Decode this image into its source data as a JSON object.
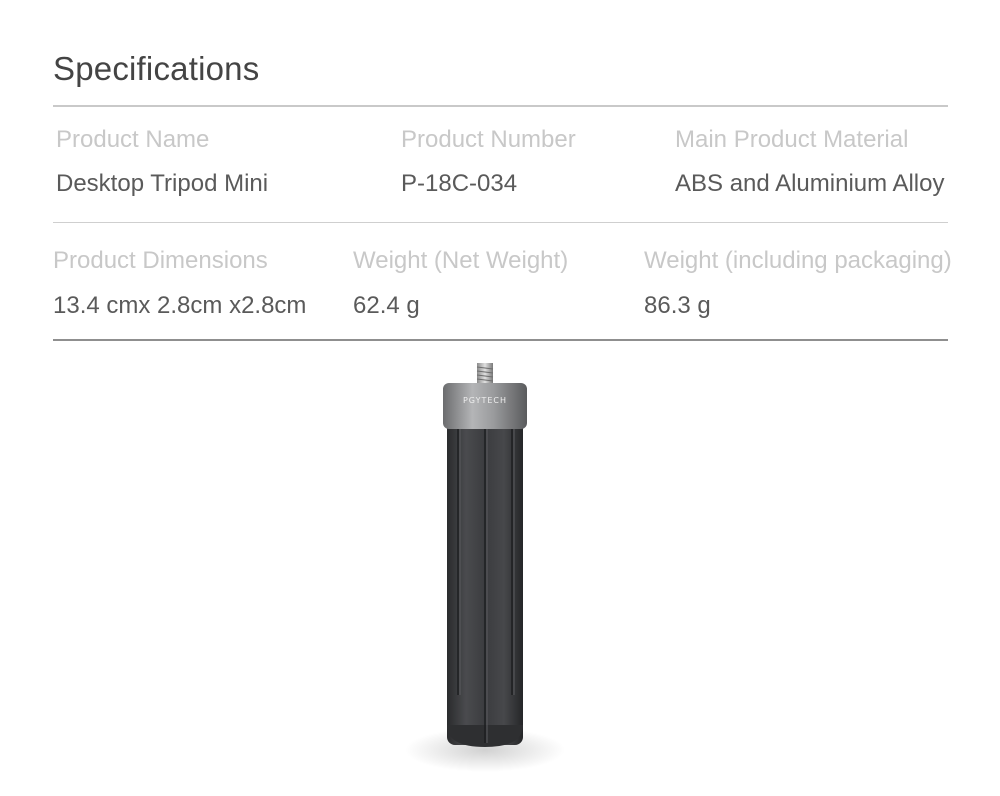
{
  "title": "Specifications",
  "specs": {
    "row1": [
      {
        "label": "Product Name",
        "value": "Desktop Tripod Mini"
      },
      {
        "label": "Product Number",
        "value": "P-18C-034"
      },
      {
        "label": "Main Product Material",
        "value": "ABS and Aluminium Alloy"
      }
    ],
    "row2": [
      {
        "label": "Product Dimensions",
        "value": "13.4 cmx 2.8cm x2.8cm"
      },
      {
        "label": "Weight (Net Weight)",
        "value": "62.4 g"
      },
      {
        "label": "Weight (including packaging)",
        "value": "86.3 g"
      }
    ]
  },
  "product_image": {
    "brand_text": "PGYTECH",
    "colors": {
      "body": "#3a3b3d",
      "cap": "#8a8b8d"
    }
  }
}
